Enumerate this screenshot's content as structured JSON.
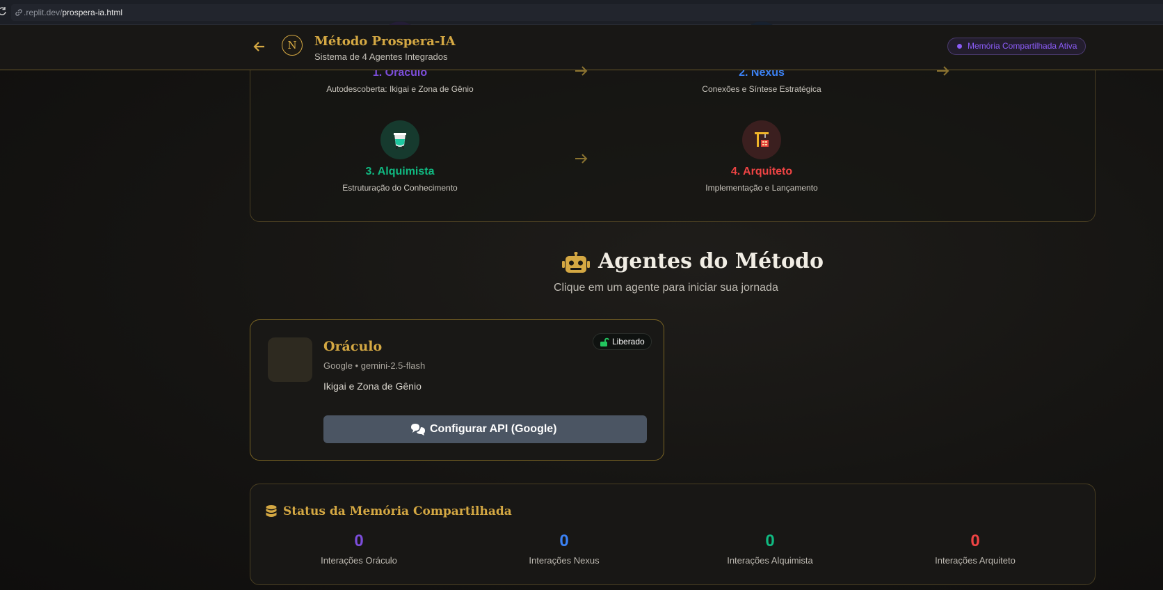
{
  "browser": {
    "url_host": ".replit.dev/",
    "url_path": "prospera-ia.html"
  },
  "header": {
    "back_icon": "arrow-left-icon",
    "logo_letter": "N",
    "title": "Método Prospera-IA",
    "subtitle": "Sistema de 4 Agentes Integrados",
    "memory_badge": "Memória Compartilhada Ativa"
  },
  "flow": {
    "steps": [
      {
        "title": "1. Oráculo",
        "desc": "Autodescoberta: Ikigai e Zona de Gênio",
        "color": "#7c4ddb",
        "icon": "crystal-ball-icon"
      },
      {
        "title": "2. Nexus",
        "desc": "Conexões e Síntese Estratégica",
        "color": "#3b82f6",
        "icon": "network-icon"
      },
      {
        "title": "3. Alquimista",
        "desc": "Estruturação do Conhecimento",
        "color": "#10b981",
        "icon": "flask-icon"
      },
      {
        "title": "4. Arquiteto",
        "desc": "Implementação e Lançamento",
        "color": "#ef4444",
        "icon": "crane-icon"
      }
    ]
  },
  "agents_section": {
    "icon": "robot-icon",
    "title": "Agentes do Método",
    "subtitle": "Clique em um agente para iniciar sua jornada"
  },
  "agent_card": {
    "name": "Oráculo",
    "model": "Google • gemini-2.5-flash",
    "description": "Ikigai e Zona de Gênio",
    "status": "Liberado",
    "button_label": "Configurar API (Google)",
    "button_icon": "comments-icon"
  },
  "memory_status": {
    "title": "Status da Memória Compartilhada",
    "icon": "database-icon",
    "stats": [
      {
        "value": "0",
        "label": "Interações Oráculo",
        "color": "#7c4ddb"
      },
      {
        "value": "0",
        "label": "Interações Nexus",
        "color": "#3b82f6"
      },
      {
        "value": "0",
        "label": "Interações Alquimista",
        "color": "#10b981"
      },
      {
        "value": "0",
        "label": "Interações Arquiteto",
        "color": "#ef4444"
      }
    ]
  },
  "colors": {
    "gold": "#d4a843",
    "purple": "#7c4ddb",
    "blue": "#3b82f6",
    "green": "#10b981",
    "red": "#ef4444"
  }
}
